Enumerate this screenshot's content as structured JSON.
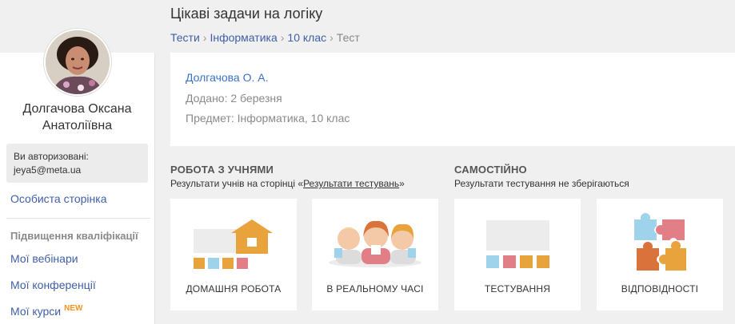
{
  "header": {
    "title": "Цікаві задачи на логіку",
    "breadcrumb": [
      "Тести",
      "Інформатика",
      "10 клас",
      "Тест"
    ]
  },
  "sidebar": {
    "user_name": "Долгачова Оксана Анатоліївна",
    "auth_label": "Ви авторизовані:",
    "auth_email": "jeya5@meta.ua",
    "personal_page": "Особиста сторінка",
    "section_heading": "Підвищення кваліфікації",
    "items": [
      {
        "label": "Мої вебінари"
      },
      {
        "label": "Мої конференції"
      },
      {
        "label": "Мої курси",
        "badge": "NEW"
      }
    ]
  },
  "info": {
    "author": "Долгачова О. А.",
    "added": "Додано: 2 березня",
    "subject": "Предмет: Інформатика, 10 клас"
  },
  "sections": {
    "students": {
      "title": "РОБОТА З УЧНЯМИ",
      "subtitle_before": "Результати учнів на сторінці «",
      "subtitle_link": "Результати тестувань",
      "subtitle_after": "»"
    },
    "self": {
      "title": "САМОСТІЙНО",
      "subtitle": "Результати тестування не зберігаються"
    }
  },
  "tiles": [
    {
      "label": "ДОМАШНЯ РОБОТА",
      "icon": "homework-house-icon"
    },
    {
      "label": "В РЕАЛЬНОМУ ЧАСІ",
      "icon": "students-group-icon"
    },
    {
      "label": "ТЕСТУВАННЯ",
      "icon": "testing-board-icon"
    },
    {
      "label": "ВІДПОВІДНОСТІ",
      "icon": "puzzle-pieces-icon"
    }
  ],
  "colors": {
    "link": "#3f5ea8",
    "accent_orange": "#e8a33c",
    "tile_blue": "#9fd3ec",
    "tile_pink": "#e27f86",
    "tile_rust": "#d9723b",
    "new_badge": "#f7931e"
  }
}
